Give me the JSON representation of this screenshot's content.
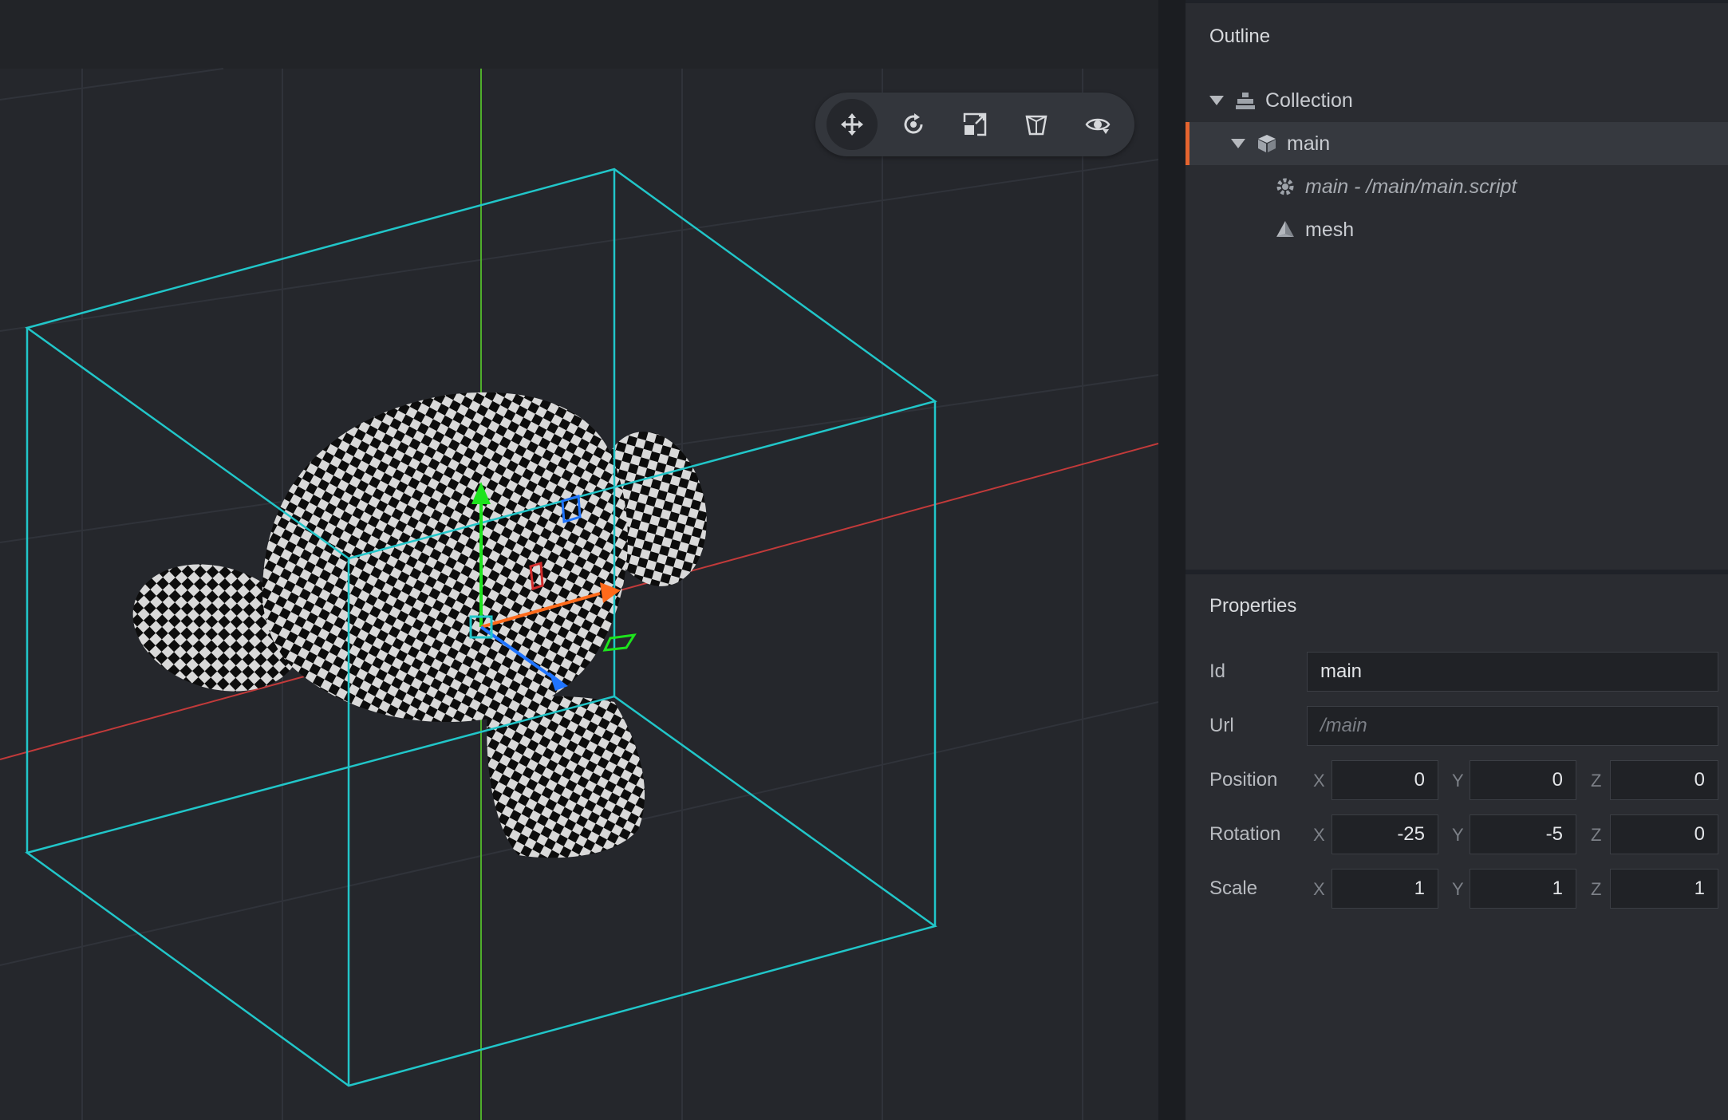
{
  "viewport": {
    "toolbar": [
      {
        "id": "move",
        "icon": "move-icon",
        "active": true
      },
      {
        "id": "rotate",
        "icon": "rotate-icon",
        "active": false
      },
      {
        "id": "scale",
        "icon": "scale-icon",
        "active": false
      },
      {
        "id": "perspective",
        "icon": "perspective-icon",
        "active": false
      },
      {
        "id": "visibility",
        "icon": "visibility-eye-icon",
        "active": false
      }
    ],
    "colors": {
      "selection_box": "#21c6c9",
      "x_axis": "#c23a3a",
      "y_axis": "#4fae2b",
      "gizmo_x": "#ff6a1a",
      "gizmo_y": "#1de41d",
      "gizmo_z": "#1f74ff"
    }
  },
  "outline": {
    "title": "Outline",
    "items": [
      {
        "label": "Collection",
        "icon": "collection-icon",
        "expanded": true
      },
      {
        "label": "main",
        "icon": "game-object-icon",
        "expanded": true,
        "selected": true
      },
      {
        "label": "main - /main/main.script",
        "icon": "script-gear-icon",
        "italic": true
      },
      {
        "label": "mesh",
        "icon": "mesh-icon"
      }
    ]
  },
  "properties": {
    "title": "Properties",
    "id": {
      "label": "Id",
      "value": "main"
    },
    "url": {
      "label": "Url",
      "placeholder": "/main"
    },
    "axes": [
      "X",
      "Y",
      "Z"
    ],
    "position": {
      "label": "Position",
      "values": [
        "0",
        "0",
        "0"
      ]
    },
    "rotation": {
      "label": "Rotation",
      "values": [
        "-25",
        "-5",
        "0"
      ]
    },
    "scale": {
      "label": "Scale",
      "values": [
        "1",
        "1",
        "1"
      ]
    }
  },
  "accent_color": "#e5642f"
}
